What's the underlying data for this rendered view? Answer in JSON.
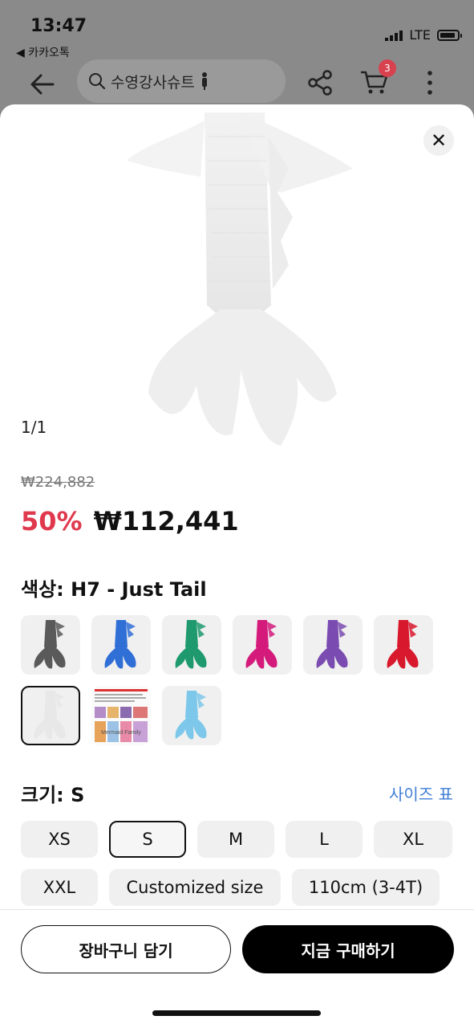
{
  "status_bar": {
    "time": "13:47",
    "back_app": "◀ 카카오톡",
    "network": "LTE"
  },
  "header": {
    "search_text": "수영강사슈트",
    "cart_count": "3",
    "icons": [
      "back-arrow-icon",
      "search-icon",
      "share-icon",
      "cart-icon",
      "more-vertical-icon"
    ]
  },
  "product": {
    "image_counter": "1/1",
    "original_price": "₩224,882",
    "discount": "50%",
    "price": "₩112,441"
  },
  "color": {
    "label": "색상: H7 - Just Tail",
    "options": [
      {
        "name": "gray",
        "color": "#5a5a5a"
      },
      {
        "name": "blue",
        "color": "#2f6fd6"
      },
      {
        "name": "green",
        "color": "#1e9a6e"
      },
      {
        "name": "pink",
        "color": "#d41b7c"
      },
      {
        "name": "purple",
        "color": "#7a4bb0"
      },
      {
        "name": "red",
        "color": "#d8192d"
      },
      {
        "name": "white",
        "color": "#e8e8e8"
      },
      {
        "name": "custom-collage",
        "color": "#c9a9c9"
      },
      {
        "name": "light-blue",
        "color": "#7cc7ea"
      }
    ],
    "selected_index": 6,
    "collage_caption": "Mermaid Family"
  },
  "size": {
    "label": "크기: S",
    "guide_link": "사이즈 표",
    "options": [
      "XS",
      "S",
      "M",
      "L",
      "XL",
      "XXL",
      "Customized size",
      "110cm (3-4T)"
    ],
    "selected": "S"
  },
  "actions": {
    "add_to_cart": "장바구니 담기",
    "buy_now": "지금 구매하기"
  },
  "colors": {
    "discount": "#e0394e",
    "link": "#3f7ed6",
    "badge": "#d8424f",
    "primary_button": "#000000"
  }
}
